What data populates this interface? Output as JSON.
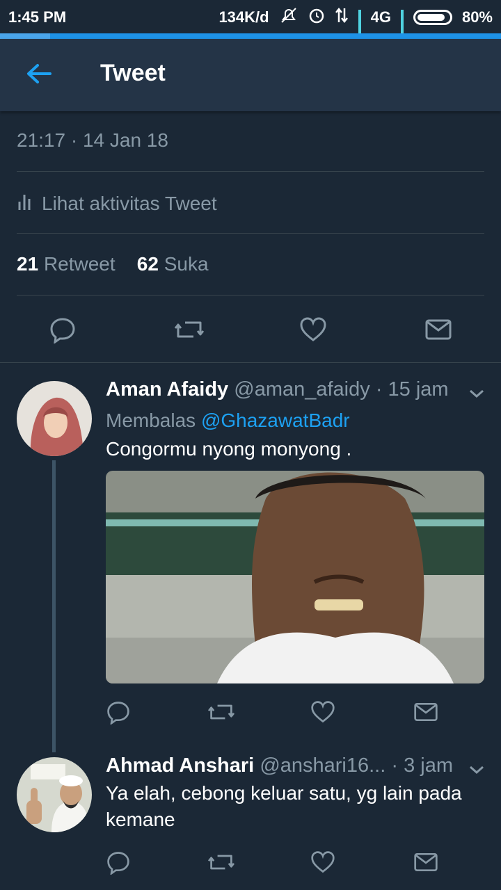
{
  "status_bar": {
    "time": "1:45 PM",
    "speed": "134K/d",
    "network": "4G",
    "battery": "80%"
  },
  "header": {
    "title": "Tweet"
  },
  "tweet": {
    "timestamp": "21:17 · 14 Jan 18",
    "activity_label": "Lihat aktivitas Tweet",
    "retweet_count": "21",
    "retweet_label": "Retweet",
    "like_count": "62",
    "like_label": "Suka"
  },
  "replies": [
    {
      "name": "Aman Afaidy",
      "handle": "@aman_afaidy",
      "time": "· 15 jam",
      "reply_prefix": "Membalas",
      "reply_mention": "@GhazawatBadr",
      "text": "Congormu nyong monyong ."
    },
    {
      "name": "Ahmad Anshari",
      "handle": "@anshari16...",
      "time": "· 3 jam",
      "text": "Ya elah, cebong keluar satu, yg lain pada kemane"
    }
  ],
  "colors": {
    "background": "#1b2836",
    "header": "#243447",
    "accent": "#1da1f2",
    "muted": "#8899a6"
  },
  "icons": [
    "back-arrow-icon",
    "reply-icon",
    "retweet-icon",
    "like-icon",
    "dm-icon",
    "chevron-down-icon",
    "activity-chart-icon"
  ]
}
